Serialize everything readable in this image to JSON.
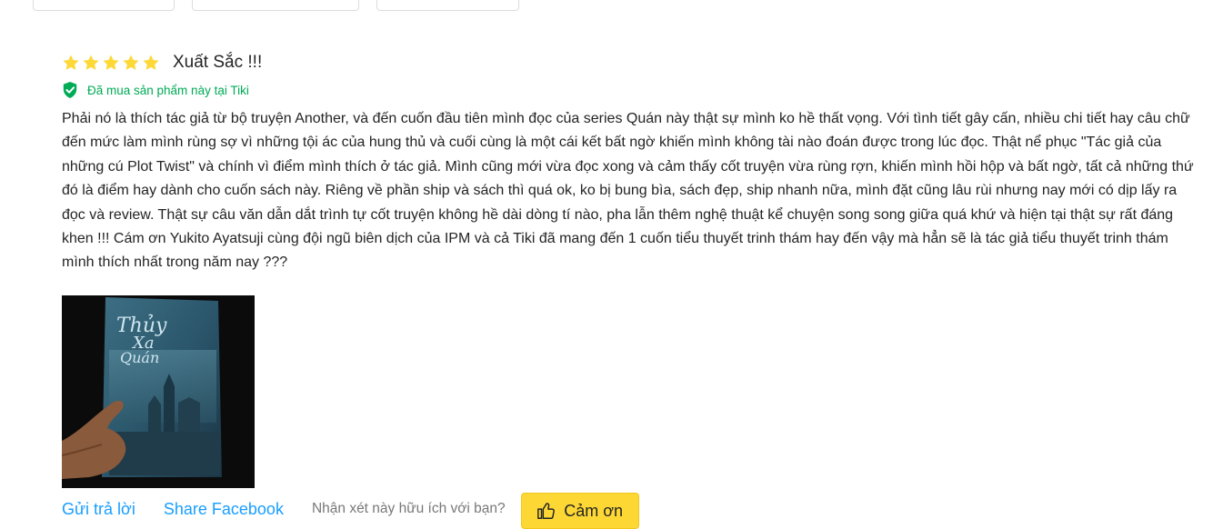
{
  "review": {
    "rating": 5,
    "rating_max": 5,
    "title": "Xuất Sắc !!!",
    "verified_text": "Đã mua sản phẩm này tại Tiki",
    "content": "Phải nó là thích tác giả từ bộ truyện Another, và đến cuốn đầu tiên mình đọc của series Quán này thật sự mình ko hề thất vọng. Với tình tiết gây cấn, nhiều chi tiết hay câu chữ đến mức làm mình rùng sợ vì những tội ác của hung thủ và cuối cùng là một cái kết bất ngờ khiến mình không tài nào đoán được trong lúc đọc. Thật nể phục \"Tác giả của những cú Plot Twist\" và chính vì điểm mình thích ở tác giả. Mình cũng mới vừa đọc xong và cảm thấy cốt truyện vừa rùng rợn, khiến mình hồi hộp và bất ngờ, tất cả những thứ đó là điểm hay dành cho cuốn sách này. Riêng về phần ship và sách thì quá ok, ko bị bung bìa, sách đẹp, ship nhanh nữa, mình đặt cũng lâu rùi nhưng nay mới có dịp lấy ra đọc và review. Thật sự câu văn dẫn dắt trình tự cốt truyện không hề dài dòng tí nào, pha lẫn thêm nghệ thuật kể chuyện song song giữa quá khứ và hiện tại thật sự rất đáng khen !!! Cám ơn Yukito Ayatsuji cùng đội ngũ biên dịch của IPM và cả Tiki đã mang đến 1 cuốn tiểu thuyết trinh thám hay đến vậy mà hẳn sẽ là tác giả tiểu thuyết trinh thám mình thích nhất trong năm nay ???"
  },
  "actions": {
    "reply_label": "Gửi trả lời",
    "share_label": "Share Facebook",
    "helpful_question": "Nhận xét này hữu ích với bạn?",
    "thanks_label": "Cảm ơn"
  },
  "colors": {
    "star": "#fdd836",
    "verified": "#00ab56",
    "link": "#189eff",
    "thanks_button": "#fdd835"
  },
  "icons": {
    "star": "star-icon",
    "verified": "shield-check-icon",
    "thanks": "thumbs-up-icon"
  }
}
